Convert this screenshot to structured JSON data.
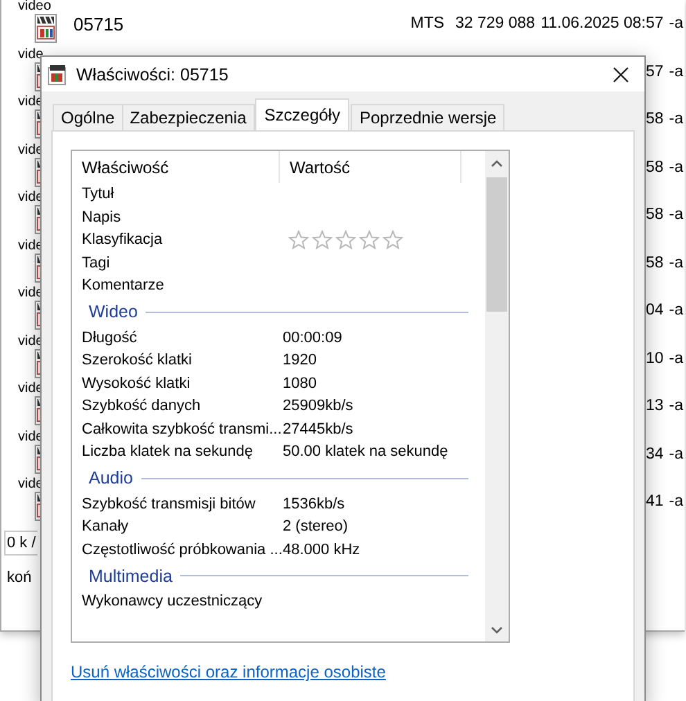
{
  "explorer": {
    "rows": [
      {
        "label": "video",
        "name": "05715",
        "type": "MTS",
        "size": "32 729 088",
        "modified": "11.06.2025 08:57",
        "attributes": "-a"
      },
      {
        "label": "vide",
        "modified": "57",
        "attributes": "-a"
      },
      {
        "label": "vide",
        "modified": "58",
        "attributes": "-a"
      },
      {
        "label": "vide",
        "modified": "58",
        "attributes": "-a"
      },
      {
        "label": "vide",
        "modified": "58",
        "attributes": "-a"
      },
      {
        "label": "vide",
        "modified": "58",
        "attributes": "-a"
      },
      {
        "label": "vide",
        "modified": "04",
        "attributes": "-a"
      },
      {
        "label": "vide",
        "modified": "10",
        "attributes": "-a"
      },
      {
        "label": "vide",
        "modified": "13",
        "attributes": "-a"
      },
      {
        "label": "vide",
        "modified": "34",
        "attributes": "-a"
      },
      {
        "label": "vide",
        "modified": "41",
        "attributes": "-a"
      }
    ],
    "status": [
      "0 k /",
      "koń"
    ]
  },
  "dialog": {
    "title": "Właściwości: 05715",
    "tabs": [
      {
        "label": "Ogólne",
        "selected": false
      },
      {
        "label": "Zabezpieczenia",
        "selected": false
      },
      {
        "label": "Szczegóły",
        "selected": true
      },
      {
        "label": "Poprzednie wersje",
        "selected": false
      }
    ],
    "columns": [
      "Właściwość",
      "Wartość"
    ],
    "rows": [
      {
        "kind": "property",
        "name": "Tytuł"
      },
      {
        "kind": "property",
        "name": "Napis"
      },
      {
        "kind": "rating",
        "name": "Klasyfikacja",
        "stars": 0
      },
      {
        "kind": "property",
        "name": "Tagi"
      },
      {
        "kind": "property",
        "name": "Komentarze"
      },
      {
        "kind": "group",
        "name": "Wideo"
      },
      {
        "kind": "property",
        "name": "Długość",
        "value": "00:00:09"
      },
      {
        "kind": "property",
        "name": "Szerokość klatki",
        "value": "1920"
      },
      {
        "kind": "property",
        "name": "Wysokość klatki",
        "value": "1080"
      },
      {
        "kind": "property",
        "name": "Szybkość danych",
        "value": "25909kb/s"
      },
      {
        "kind": "property",
        "name": "Całkowita szybkość transmi...",
        "value": "27445kb/s"
      },
      {
        "kind": "property",
        "name": "Liczba klatek na sekundę",
        "value": "50.00 klatek na sekundę"
      },
      {
        "kind": "group",
        "name": "Audio"
      },
      {
        "kind": "property",
        "name": "Szybkość transmisji bitów",
        "value": "1536kb/s"
      },
      {
        "kind": "property",
        "name": "Kanały",
        "value": "2 (stereo)"
      },
      {
        "kind": "property",
        "name": "Częstotliwość próbkowania ...",
        "value": "48.000 kHz"
      },
      {
        "kind": "group",
        "name": "Multimedia"
      },
      {
        "kind": "property",
        "name": "Wykonawcy uczestniczący"
      }
    ],
    "link": "Usuń właściwości oraz informacje osobiste"
  }
}
